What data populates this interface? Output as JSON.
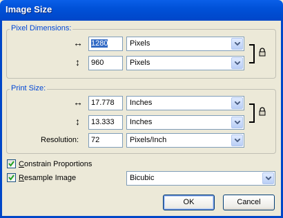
{
  "window": {
    "title": "Image Size"
  },
  "pixel_dimensions": {
    "legend": "Pixel Dimensions:",
    "width": {
      "value": "1280",
      "unit": "Pixels"
    },
    "height": {
      "value": "960",
      "unit": "Pixels"
    }
  },
  "print_size": {
    "legend": "Print Size:",
    "width": {
      "value": "17.778",
      "unit": "Inches"
    },
    "height": {
      "value": "13.333",
      "unit": "Inches"
    },
    "resolution": {
      "label": "Resolution:",
      "value": "72",
      "unit": "Pixels/Inch"
    }
  },
  "options": {
    "constrain": {
      "label_first": "C",
      "label_rest": "onstrain Proportions",
      "checked": true
    },
    "resample": {
      "label_first": "R",
      "label_rest": "esample Image",
      "checked": true,
      "method": "Bicubic"
    }
  },
  "buttons": {
    "ok": "OK",
    "cancel": "Cancel"
  },
  "icons": {
    "width_arrow": "↔",
    "height_arrow": "↕"
  },
  "colors": {
    "title_bar": "#0046c8",
    "legend_text": "#0046d5",
    "selection": "#316ac5"
  }
}
